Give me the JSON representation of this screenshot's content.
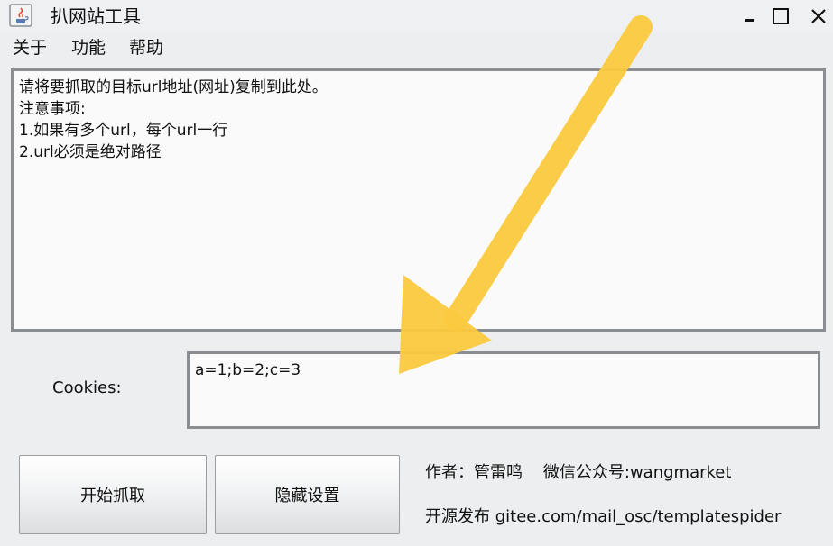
{
  "window": {
    "title": "扒网站工具",
    "icon": "java-cup-icon"
  },
  "menu": {
    "items": [
      {
        "label": "关于"
      },
      {
        "label": "功能"
      },
      {
        "label": "帮助"
      }
    ]
  },
  "main_textarea": {
    "lines": [
      "请将要抓取的目标url地址(网址)复制到此处。",
      "注意事项:",
      "1.如果有多个url，每个url一行",
      "2.url必须是绝对路径"
    ]
  },
  "cookies": {
    "label": "Cookies:",
    "value": "a=1;b=2;c=3"
  },
  "buttons": {
    "start_label": "开始抓取",
    "hide_label": "隐藏设置"
  },
  "info": {
    "author": "作者：管雷鸣    微信公众号:wangmarket",
    "source": "开源发布 gitee.com/mail_osc/templatespider"
  },
  "colors": {
    "annotation_arrow": "#fbc93e",
    "border": "#8a8d92",
    "background": "#eceef0"
  }
}
